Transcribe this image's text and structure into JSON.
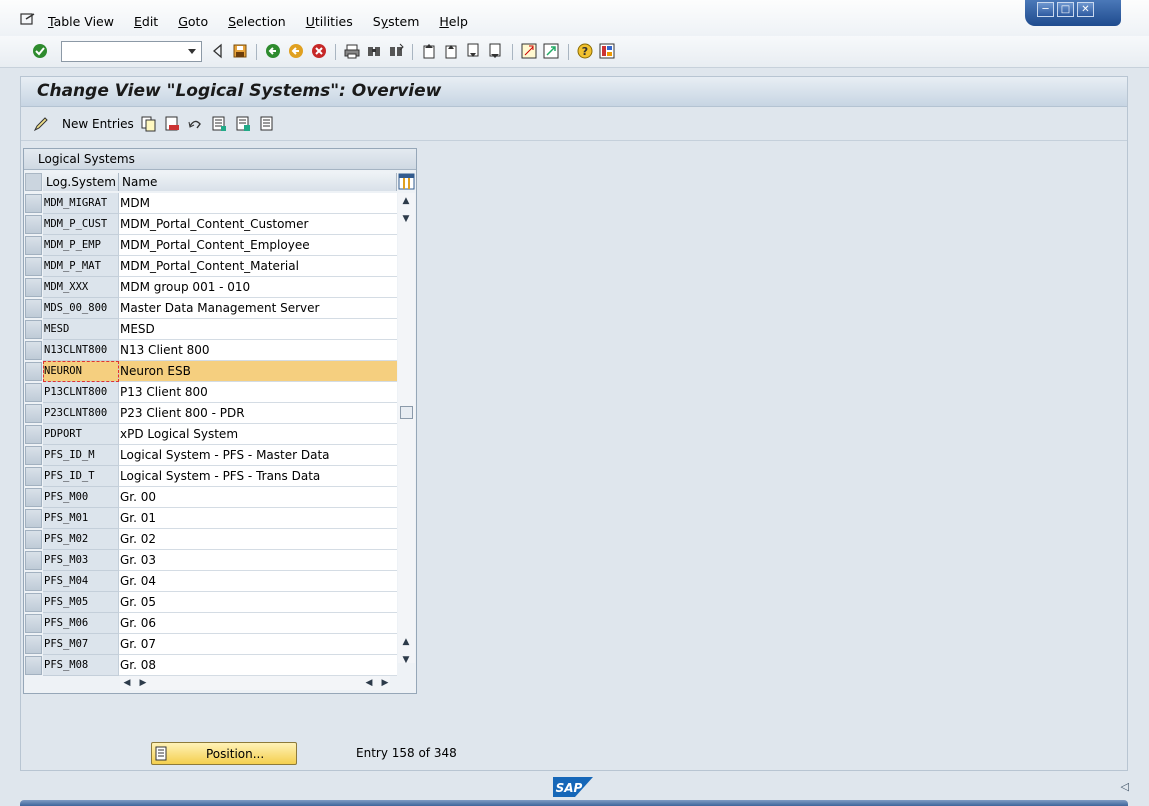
{
  "menu": {
    "items": [
      {
        "label": "Table View",
        "underline": "T"
      },
      {
        "label": "Edit",
        "underline": "E"
      },
      {
        "label": "Goto",
        "underline": "G"
      },
      {
        "label": "Selection",
        "underline": "S"
      },
      {
        "label": "Utilities",
        "underline": "U"
      },
      {
        "label": "System",
        "underline": "y"
      },
      {
        "label": "Help",
        "underline": "H"
      }
    ]
  },
  "toolbar": {
    "command_field_value": "",
    "icons": [
      "enter-icon",
      "command-field",
      "back-icon",
      "save-icon",
      "back-green-icon",
      "exit-icon",
      "cancel-icon",
      "print-icon",
      "find-icon",
      "find-next-icon",
      "first-page-icon",
      "previous-page-icon",
      "next-page-icon",
      "last-page-icon",
      "create-session-icon",
      "shortcut-icon",
      "help-icon",
      "layout-icon"
    ]
  },
  "screen": {
    "title": "Change View \"Logical Systems\": Overview",
    "new_entries_label": "New Entries"
  },
  "table": {
    "title": "Logical Systems",
    "columns": [
      "Log.System",
      "Name"
    ],
    "rows": [
      {
        "system": "MDM_MIGRAT",
        "name": "MDM"
      },
      {
        "system": "MDM_P_CUST",
        "name": "MDM_Portal_Content_Customer"
      },
      {
        "system": "MDM_P_EMP",
        "name": "MDM_Portal_Content_Employee"
      },
      {
        "system": "MDM_P_MAT",
        "name": "MDM_Portal_Content_Material"
      },
      {
        "system": "MDM_XXX",
        "name": "MDM group 001 - 010"
      },
      {
        "system": "MDS_00_800",
        "name": "Master Data Management Server"
      },
      {
        "system": "MESD",
        "name": "MESD"
      },
      {
        "system": "N13CLNT800",
        "name": "N13 Client 800"
      },
      {
        "system": "NEURON",
        "name": "Neuron ESB",
        "highlighted": true
      },
      {
        "system": "P13CLNT800",
        "name": "P13 Client 800"
      },
      {
        "system": "P23CLNT800",
        "name": "P23 Client 800 - PDR"
      },
      {
        "system": "PDPORT",
        "name": "xPD Logical System"
      },
      {
        "system": "PFS_ID_M",
        "name": "Logical System - PFS - Master Data"
      },
      {
        "system": "PFS_ID_T",
        "name": "Logical System - PFS - Trans Data"
      },
      {
        "system": "PFS_M00",
        "name": "Gr. 00"
      },
      {
        "system": "PFS_M01",
        "name": "Gr. 01"
      },
      {
        "system": "PFS_M02",
        "name": "Gr. 02"
      },
      {
        "system": "PFS_M03",
        "name": "Gr. 03"
      },
      {
        "system": "PFS_M04",
        "name": "Gr. 04"
      },
      {
        "system": "PFS_M05",
        "name": "Gr. 05"
      },
      {
        "system": "PFS_M06",
        "name": "Gr. 06"
      },
      {
        "system": "PFS_M07",
        "name": "Gr. 07"
      },
      {
        "system": "PFS_M08",
        "name": "Gr. 08"
      }
    ]
  },
  "footer": {
    "position_button": "Position...",
    "entry_text": "Entry 158 of 348"
  },
  "status": {
    "logo": "SAP"
  },
  "colors": {
    "highlight": "#f5cf7f",
    "title_text": "#1a1a1a",
    "window_controls": "#2d5aa0"
  }
}
